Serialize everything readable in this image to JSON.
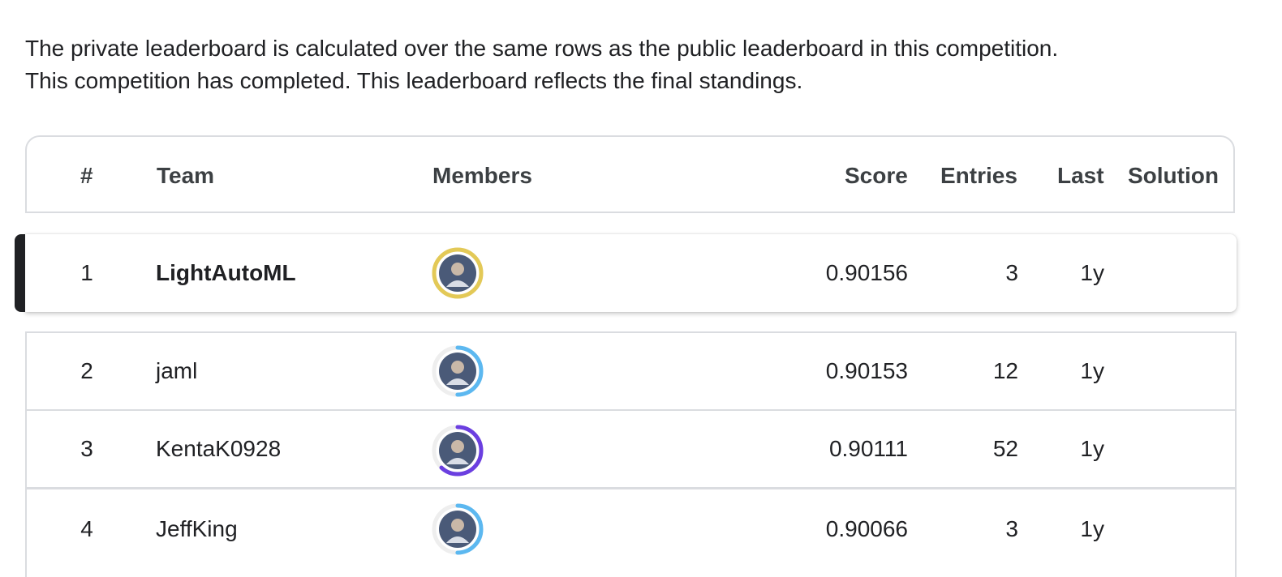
{
  "intro": {
    "line1": "The private leaderboard is calculated over the same rows as the public leaderboard in this competition.",
    "line2": "This competition has completed. This leaderboard reflects the final standings."
  },
  "columns": {
    "rank": "#",
    "team": "Team",
    "members": "Members",
    "score": "Score",
    "entries": "Entries",
    "last": "Last",
    "solution": "Solution"
  },
  "rows": [
    {
      "rank": "1",
      "team": "LightAutoML",
      "score": "0.90156",
      "entries": "3",
      "last": "1y",
      "avatar_icon": "user-avatar",
      "tier_color": "#e3c957",
      "ring_fraction": 1.0
    },
    {
      "rank": "2",
      "team": "jaml",
      "score": "0.90153",
      "entries": "12",
      "last": "1y",
      "avatar_icon": "user-avatar",
      "tier_color": "#5cb8f0",
      "ring_fraction": 0.5
    },
    {
      "rank": "3",
      "team": "KentaK0928",
      "score": "0.90111",
      "entries": "52",
      "last": "1y",
      "avatar_icon": "user-avatar",
      "tier_color": "#6b3fe0",
      "ring_fraction": 0.62
    },
    {
      "rank": "4",
      "team": "JeffKing",
      "score": "0.90066",
      "entries": "3",
      "last": "1y",
      "avatar_icon": "user-avatar",
      "tier_color": "#5cb8f0",
      "ring_fraction": 0.5
    }
  ]
}
